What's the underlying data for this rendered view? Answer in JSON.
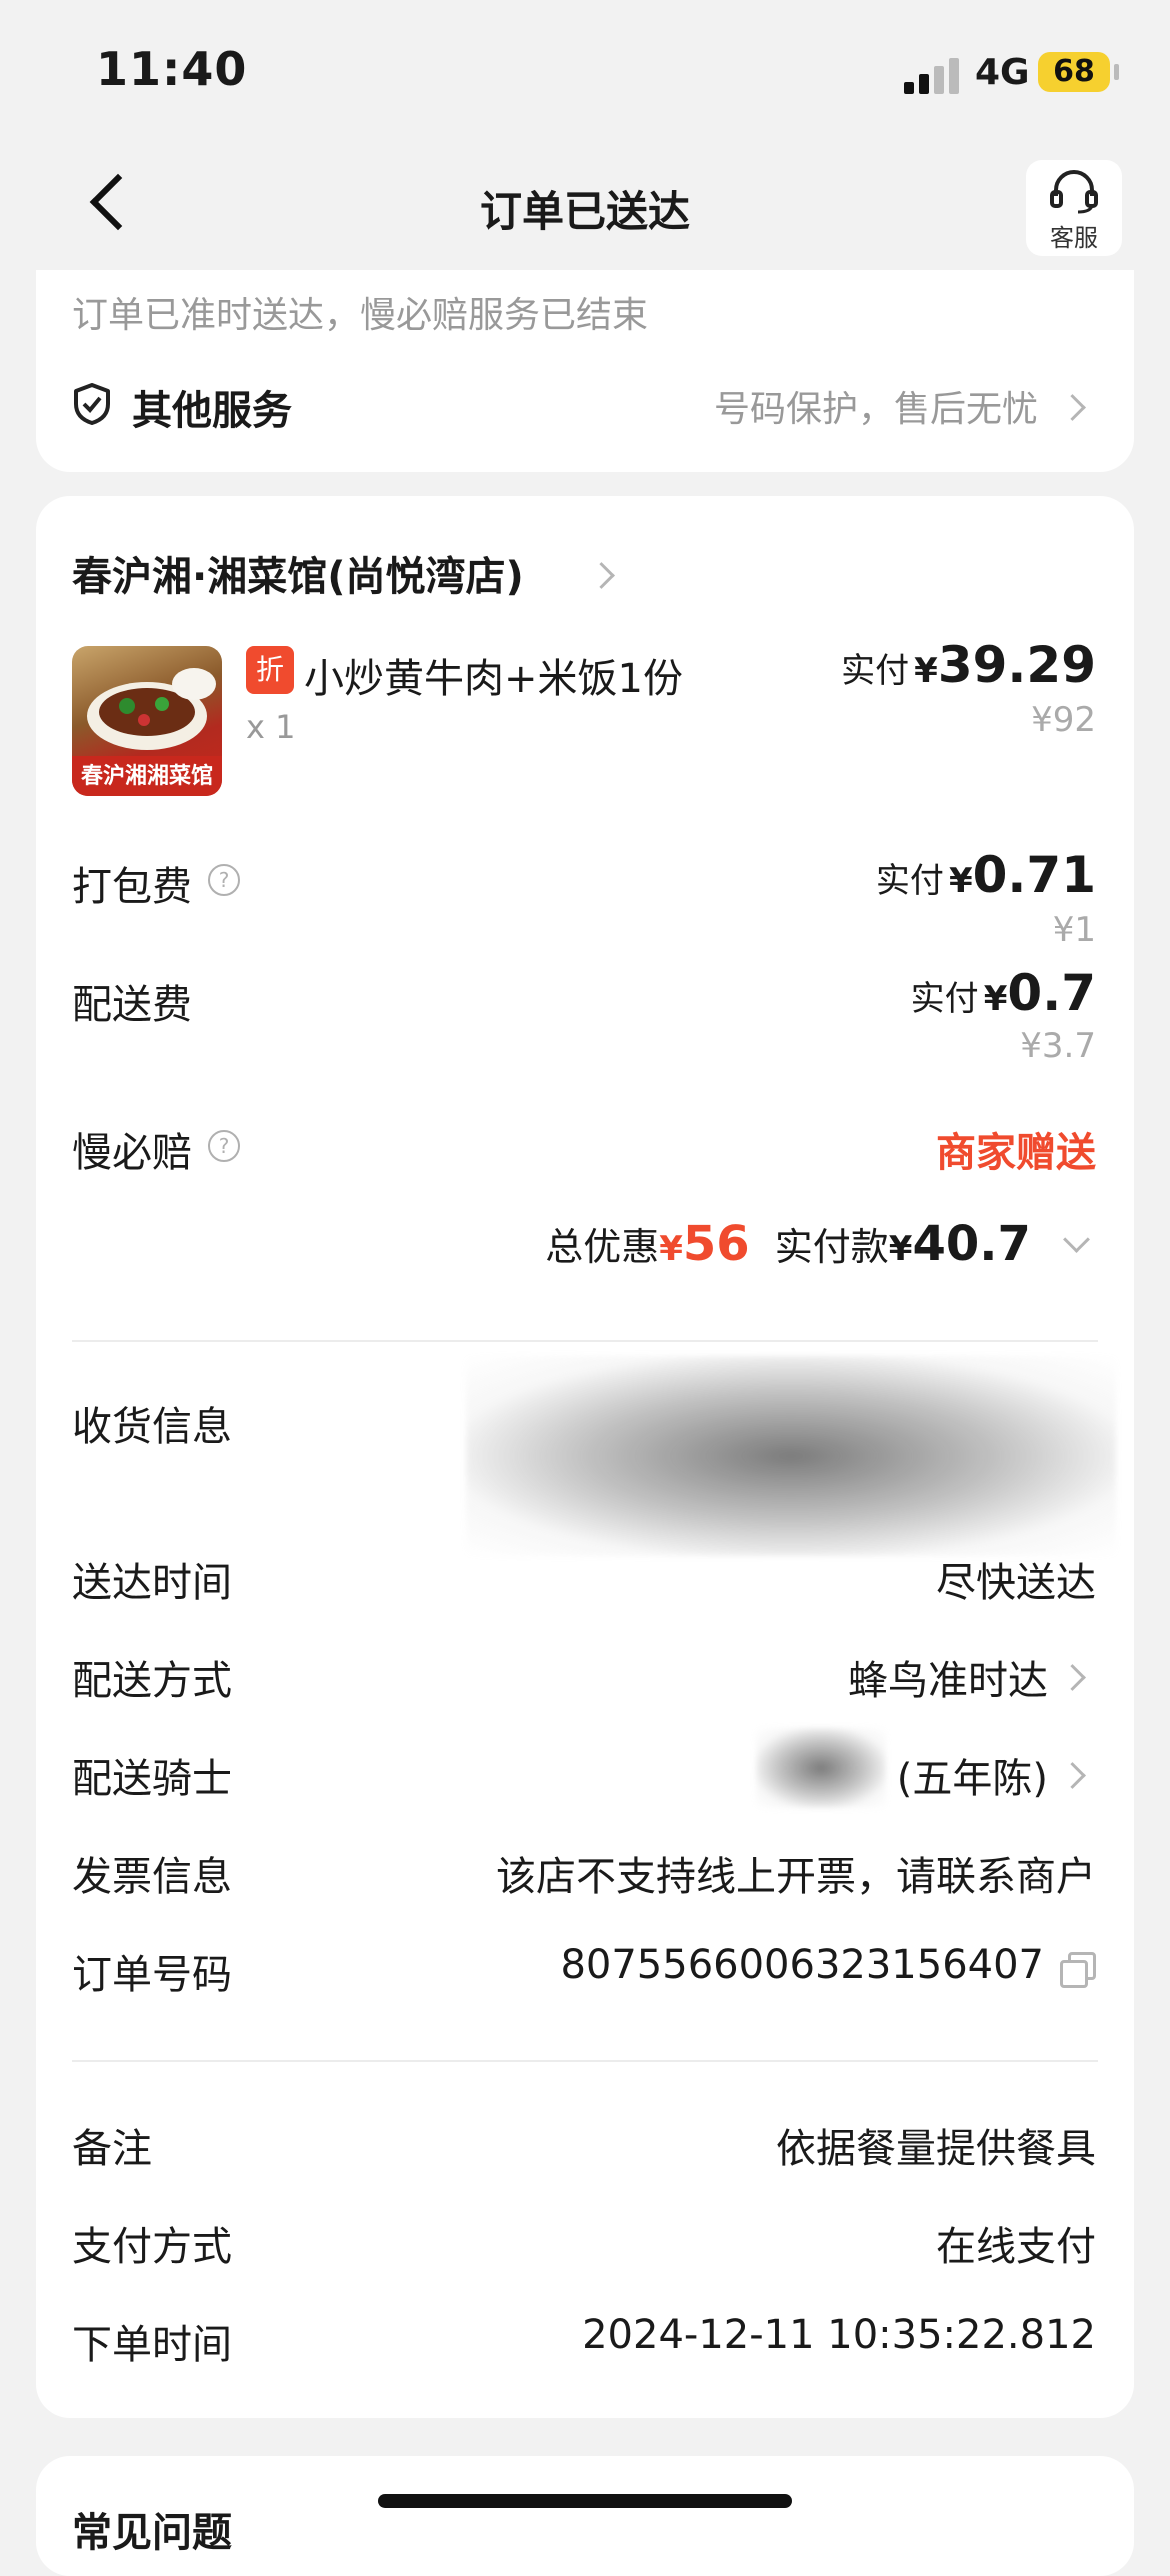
{
  "status_bar": {
    "time": "11:40",
    "network": "4G",
    "battery": "68"
  },
  "nav": {
    "title": "订单已送达",
    "service_label": "客服"
  },
  "top_card": {
    "notice": "订单已准时送达，慢必赔服务已结束",
    "other_services_label": "其他服务",
    "other_services_value": "号码保护，售后无忧"
  },
  "order": {
    "store_name": "春沪湘·湘菜馆(尚悦湾店)",
    "item": {
      "discount_tag": "折",
      "name": "小炒黄牛肉+米饭1份",
      "qty": "x 1",
      "paid_label": "实付",
      "currency": "¥",
      "paid": "39.29",
      "original": "¥92",
      "image_caption": "春沪湘湘菜馆"
    },
    "packing_fee": {
      "label": "打包费",
      "paid_label": "实付",
      "currency": "¥",
      "paid": "0.71",
      "original": "¥1"
    },
    "delivery_fee": {
      "label": "配送费",
      "paid_label": "实付",
      "currency": "¥",
      "paid": "0.7",
      "original": "¥3.7"
    },
    "slow_guarantee": {
      "label": "慢必赔",
      "value": "商家赠送"
    },
    "totals": {
      "discount_label": "总优惠",
      "currency": "¥",
      "discount": "56",
      "paid_label": "实付款",
      "paid": "40.7"
    }
  },
  "delivery_info": [
    {
      "label": "收货信息",
      "value": ""
    },
    {
      "label": "送达时间",
      "value": "尽快送达"
    },
    {
      "label": "配送方式",
      "value": "蜂鸟准时达"
    },
    {
      "label": "配送骑士",
      "value": "(五年陈)"
    },
    {
      "label": "发票信息",
      "value": "该店不支持线上开票，请联系商户"
    },
    {
      "label": "订单号码",
      "value": "8075566006323156407"
    }
  ],
  "extra_info": [
    {
      "label": "备注",
      "value": "依据餐量提供餐具"
    },
    {
      "label": "支付方式",
      "value": "在线支付"
    },
    {
      "label": "下单时间",
      "value": "2024-12-11 10:35:22.812"
    }
  ],
  "faq": {
    "title": "常见问题"
  }
}
